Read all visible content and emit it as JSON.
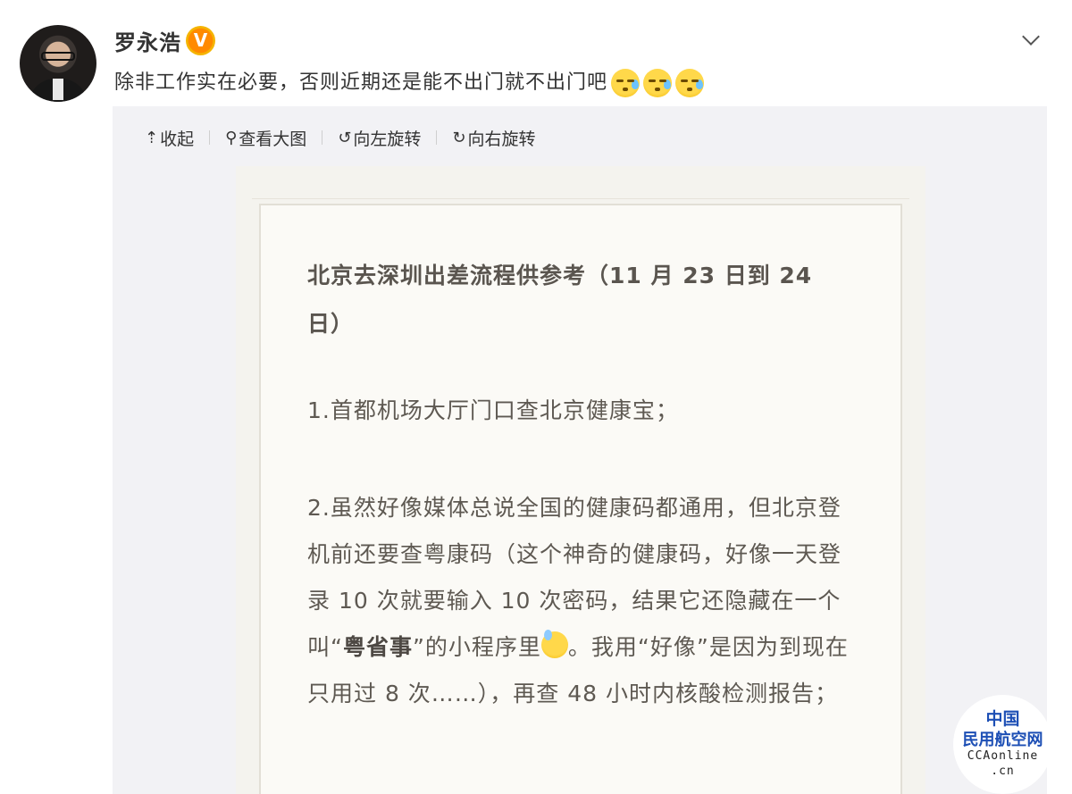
{
  "post": {
    "username": "罗永浩",
    "verified_badge": "V",
    "text": "除非工作实在必要，否则近期还是能不出门就不出门吧",
    "emoji_count": 3,
    "emoji_icon": "sweat-face-icon"
  },
  "toolbar": {
    "collapse_label": "收起",
    "view_large_label": "查看大图",
    "rotate_left_label": "向左旋转",
    "rotate_right_label": "向右旋转"
  },
  "image_text": {
    "title": "北京去深圳出差流程供参考（11 月 23 日到 24 日）",
    "item1": "1.首都机场大厅门口查北京健康宝；",
    "item2_a": "2.虽然好像媒体总说全国的健康码都通用，但北京登机前还要查粤康码（这个神奇的健康码，好像一天登录 10 次就要输入 10 次密码，结果它还隐藏在一个叫“",
    "item2_bold": "粤省事",
    "item2_b": "”的小程序里",
    "item2_c": "。我用“好像”是因为到现在只用过 8 次……），再查 48 小时内核酸检测报告；"
  },
  "watermark": {
    "line1": "中国",
    "line2": "民用航空网",
    "line3": "CCAonline",
    "line4": ".cn"
  }
}
